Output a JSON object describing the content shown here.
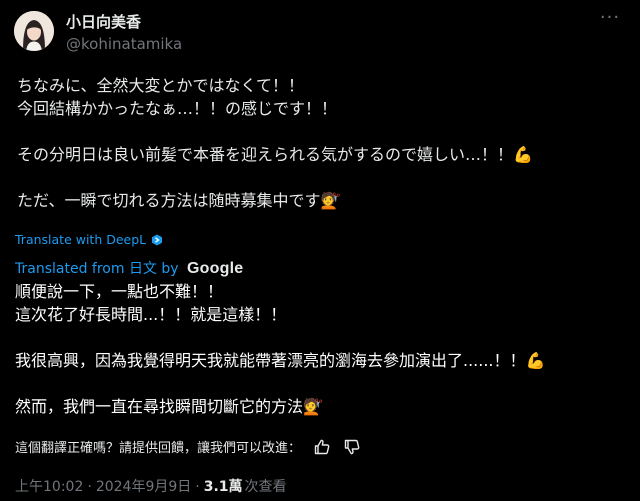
{
  "user": {
    "display_name": "小日向美香",
    "handle": "@kohinatamika"
  },
  "tweet": {
    "lines": [
      "ちなみに、全然大変とかではなくて！！",
      "今回結構かかったなぁ…！！の感じです！！",
      "",
      "その分明日は良い前髪で本番を迎えられる気がするので嬉しい…！！💪",
      "",
      "ただ、一瞬で切れる方法は随時募集中です💇"
    ]
  },
  "translation": {
    "deepl_link": "Translate with DeepL",
    "translated_from_prefix": "Translated from ",
    "source_language": "日文",
    "by": " by ",
    "provider": "Google",
    "lines": [
      "順便說一下，一點也不難！！",
      "這次花了好長時間...！！就是這樣！！",
      "",
      "我很高興，因為我覺得明天我就能帶著漂亮的瀏海去參加演出了......！！💪",
      "",
      "然而，我們一直在尋找瞬間切斷它的方法💇"
    ],
    "feedback_prompt": "這個翻譯正確嗎？請提供回饋，讓我們可以改進："
  },
  "meta": {
    "time": "上午10:02",
    "date": "2024年9月9日",
    "separator": "·",
    "views": "3.1萬",
    "views_label": "次查看"
  },
  "icons": {
    "more": "more-options-icon",
    "deepl": "deepl-icon",
    "thumbs_up": "thumbs-up-icon",
    "thumbs_down": "thumbs-down-icon"
  },
  "colors": {
    "background": "#000000",
    "text": "#e7e9ea",
    "muted": "#71767b",
    "link": "#1d9bf0"
  }
}
